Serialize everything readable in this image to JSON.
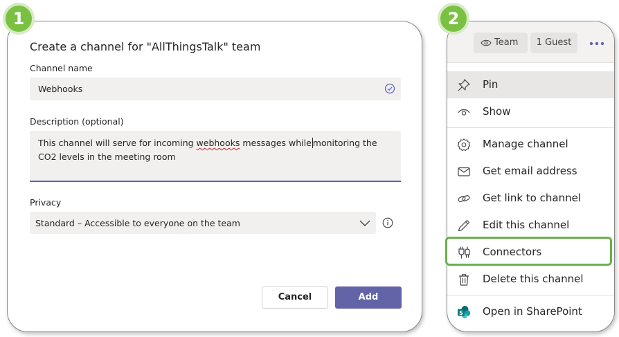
{
  "badges": {
    "step1": "1",
    "step2": "2"
  },
  "dialog": {
    "title": "Create a channel for \"AllThingsTalk\" team",
    "channel_name_label": "Channel name",
    "channel_name_value": "Webhooks",
    "description_label": "Description (optional)",
    "description_part1": "This channel will serve for incoming ",
    "description_misspelled": "webhooks",
    "description_part2": " messages while",
    "description_part3": "monitoring the CO2 levels in the meeting room",
    "privacy_label": "Privacy",
    "privacy_value": "Standard – Accessible to everyone on the team",
    "cancel_label": "Cancel",
    "add_label": "Add"
  },
  "menu": {
    "header": {
      "team_chip": "Team",
      "guest_chip": "1 Guest"
    },
    "items": [
      {
        "label": "Pin",
        "icon": "pin-icon"
      },
      {
        "label": "Show",
        "icon": "eye-icon"
      },
      {
        "label": "Manage channel",
        "icon": "gear-icon"
      },
      {
        "label": "Get email address",
        "icon": "envelope-icon"
      },
      {
        "label": "Get link to channel",
        "icon": "link-icon"
      },
      {
        "label": "Edit this channel",
        "icon": "pencil-icon"
      },
      {
        "label": "Connectors",
        "icon": "connector-icon"
      },
      {
        "label": "Delete this channel",
        "icon": "trash-icon"
      },
      {
        "label": "Open in SharePoint",
        "icon": "sharepoint-icon"
      }
    ]
  },
  "colors": {
    "accent": "#6264a7",
    "highlight": "#6ab04c",
    "badge": "#7ac143",
    "input_bg": "#f1f0ef"
  }
}
